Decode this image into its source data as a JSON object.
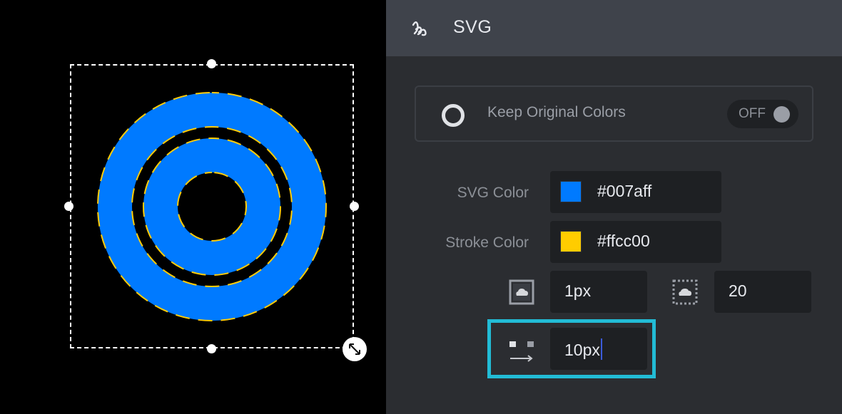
{
  "panel": {
    "title": "SVG",
    "title_icon": "svg-scribble-icon",
    "keep_original_colors": {
      "label": "Keep Original Colors",
      "icon": "ring-icon",
      "toggle_text": "OFF",
      "enabled": false
    },
    "svg_color": {
      "label": "SVG Color",
      "value": "#007aff"
    },
    "stroke_color": {
      "label": "Stroke Color",
      "value": "#ffcc00"
    },
    "stroke_width": {
      "icon": "stroke-width-icon",
      "value": "1px"
    },
    "stroke_dasharray": {
      "icon": "stroke-dash-icon",
      "value": "20"
    },
    "stroke_dashoffset": {
      "icon": "dash-offset-icon",
      "value": "10px"
    }
  },
  "colors": {
    "canvas_bg": "#000000",
    "panel_bg": "#2b2d31",
    "header_bg": "#3f434b",
    "fill": "#007aff",
    "stroke": "#ffcc00",
    "focus": "#22bcd6"
  }
}
